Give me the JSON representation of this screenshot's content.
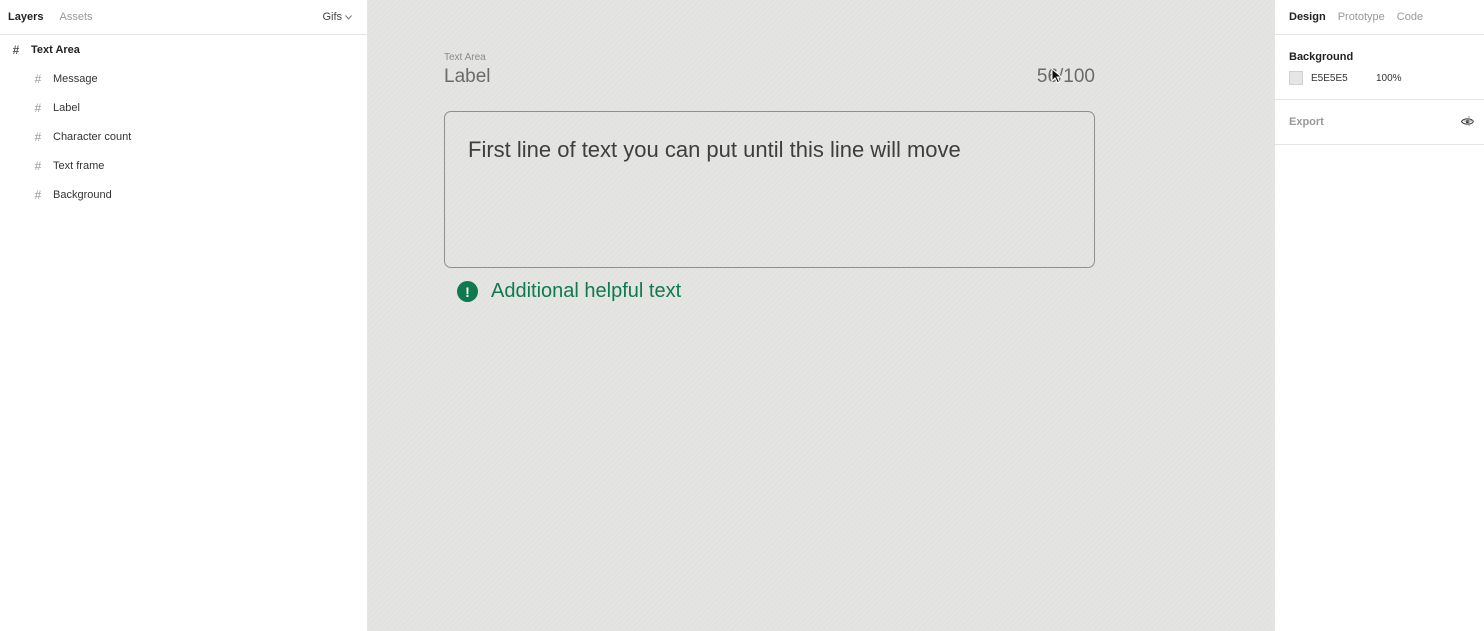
{
  "left_panel": {
    "tabs": [
      {
        "label": "Layers",
        "active": true
      },
      {
        "label": "Assets",
        "active": false
      }
    ],
    "page_select": "Gifs",
    "layers": [
      {
        "label": "Text Area",
        "icon": "frame-icon",
        "root": true
      },
      {
        "label": "Message",
        "icon": "frame-icon"
      },
      {
        "label": "Label",
        "icon": "frame-icon"
      },
      {
        "label": "Character count",
        "icon": "frame-icon"
      },
      {
        "label": "Text frame",
        "icon": "frame-icon"
      },
      {
        "label": "Background",
        "icon": "frame-icon"
      }
    ]
  },
  "canvas": {
    "frame_name": "Text Area",
    "label": "Label",
    "count": "56/100",
    "message": "First line of text you can put until this line will move",
    "helper_text": "Additional helpful text",
    "helper_icon": "!",
    "colors": {
      "background": "#E2E2E1",
      "helper": "#0F7A4E",
      "border": "#8F8F8F"
    }
  },
  "right_panel": {
    "tabs": [
      {
        "label": "Design",
        "active": true
      },
      {
        "label": "Prototype",
        "active": false
      },
      {
        "label": "Code",
        "active": false
      }
    ],
    "background": {
      "title": "Background",
      "hex": "E5E5E5",
      "opacity": "100%",
      "swatch_color": "#E5E5E5"
    },
    "export": {
      "title": "Export",
      "add_icon": "plus-icon"
    }
  }
}
